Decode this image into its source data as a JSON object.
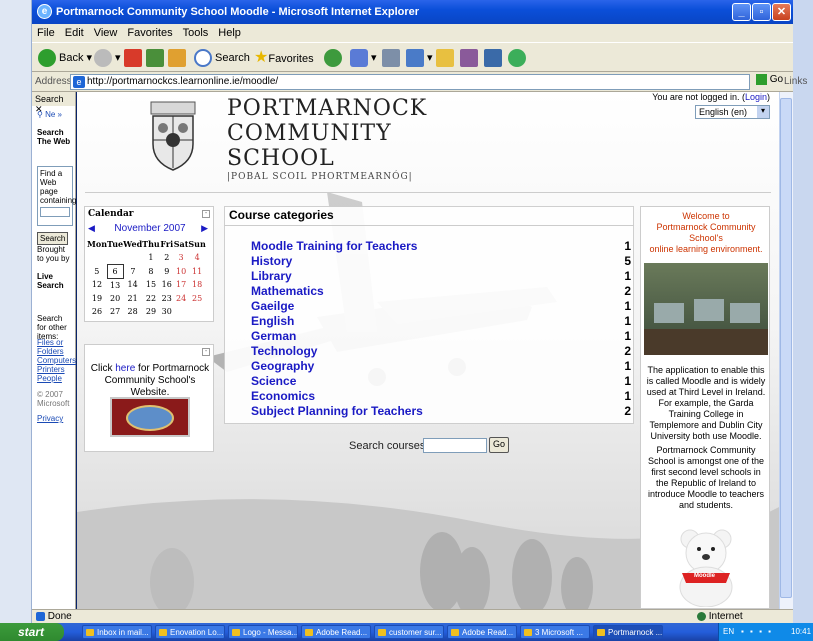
{
  "window": {
    "title": "Portmarnock Community School Moodle - Microsoft Internet Explorer"
  },
  "menu": [
    "File",
    "Edit",
    "View",
    "Favorites",
    "Tools",
    "Help"
  ],
  "toolbar": {
    "back": "Back",
    "search": "Search",
    "favorites": "Favorites"
  },
  "address": {
    "label": "Address",
    "url": "http://portmarnockcs.learnonline.ie/moodle/",
    "go": "Go",
    "links": "Links"
  },
  "search_pane": {
    "title": "Search",
    "tab": "Ne",
    "heading": "Search The Web",
    "find_text": "Find a Web page containing",
    "button": "Search",
    "brought": "Brought to you by",
    "live_search": "Live Search",
    "other_items": "Search for other items:",
    "links": [
      "Files or Folders",
      "Computers",
      "Printers",
      "People"
    ],
    "copyright": "© 2007 Microsoft",
    "privacy": "Privacy"
  },
  "header": {
    "school_line1": "PORTMARNOCK",
    "school_line2": "COMMUNITY",
    "school_line3": "SCHOOL",
    "irish_name": "|POBAL SCOIL PHORTMEARNÓG|",
    "login_text": "You are not logged in. (",
    "login_link": "Login",
    "login_close": ")",
    "language": "English (en)"
  },
  "calendar": {
    "title": "Calendar",
    "month": "November 2007",
    "weekdays": [
      "Mon",
      "Tue",
      "Wed",
      "Thu",
      "Fri",
      "Sat",
      "Sun"
    ],
    "weeks": [
      [
        "",
        "",
        "",
        "1",
        "2",
        "3",
        "4"
      ],
      [
        "5",
        "6",
        "7",
        "8",
        "9",
        "10",
        "11"
      ],
      [
        "12",
        "13",
        "14",
        "15",
        "16",
        "17",
        "18"
      ],
      [
        "19",
        "20",
        "21",
        "22",
        "23",
        "24",
        "25"
      ],
      [
        "26",
        "27",
        "28",
        "29",
        "30",
        "",
        ""
      ]
    ],
    "today": "6"
  },
  "website_block": {
    "text_before": "Click ",
    "link": "here",
    "text_after": " for Portmarnock Community School's Website."
  },
  "course_categories": {
    "title": "Course categories",
    "items": [
      {
        "name": "Moodle Training for Teachers",
        "count": "1"
      },
      {
        "name": "History",
        "count": "5"
      },
      {
        "name": "Library",
        "count": "1"
      },
      {
        "name": "Mathematics",
        "count": "2"
      },
      {
        "name": "Gaeilge",
        "count": "1"
      },
      {
        "name": "English",
        "count": "1"
      },
      {
        "name": "German",
        "count": "1"
      },
      {
        "name": "Technology",
        "count": "2"
      },
      {
        "name": "Geography",
        "count": "1"
      },
      {
        "name": "Science",
        "count": "1"
      },
      {
        "name": "Economics",
        "count": "1"
      },
      {
        "name": "Subject Planning for Teachers",
        "count": "2"
      }
    ],
    "search_label": "Search courses:",
    "search_go": "Go"
  },
  "welcome": {
    "line1": "Welcome to",
    "line2": "Portmarnock Community School's",
    "line3": "online learning environment.",
    "para1": "The application to enable this is called Moodle and is widely used at Third Level in Ireland. For example, the Garda Training College in Templemore and Dublin City University both use Moodle.",
    "para2": "Portmarnock Community School is amongst one of the first second level schools in the Republic of Ireland to introduce Moodle to teachers and students.",
    "bear_label": "Moodle"
  },
  "status": {
    "done": "Done",
    "zone": "Internet"
  },
  "taskbar": {
    "start": "start",
    "tasks": [
      "Inbox in mail...",
      "Enovation Lo...",
      "Logo - Messa...",
      "Adobe Read...",
      "customer sur...",
      "Adobe Read...",
      "3 Microsoft ...",
      "Portmarnock ..."
    ],
    "lang": "EN",
    "clock": "10:41"
  },
  "colors": {
    "title_blue": "#0b4fd9",
    "link_blue": "#1a1ac4",
    "welcome_red": "#cc3300"
  }
}
